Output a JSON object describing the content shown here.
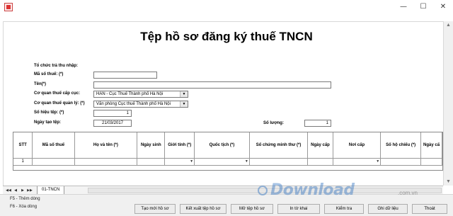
{
  "window": {
    "minimize": "—",
    "maximize": "☐",
    "close": "✕"
  },
  "form": {
    "title": "Tệp hồ sơ đăng ký thuế TNCN",
    "org_label": "Tổ chức trả thu nhập:",
    "tax_code_label": "Mã số thuế: (*)",
    "tax_code_value": "",
    "name_label": "Tên(*)",
    "name_value": "",
    "dept_label": "Cơ quan thuế cấp cục:",
    "dept_value": "HAN - Cục Thuế Thành phố Hà Nội",
    "manager_label": "Cơ quan thuế quản lý: (*)",
    "manager_value": "Văn phòng Cục thuế Thành phố Hà Nội",
    "file_no_label": "Số hiệu tệp: (*)",
    "file_no_value": "1",
    "date_label": "Ngày tạo tệp:",
    "date_value": "21/03/2017",
    "qty_label": "Số lượng:",
    "qty_value": "1"
  },
  "grid": {
    "columns": [
      "STT",
      "Mã số thuế",
      "Họ và tên (*)",
      "Ngày sinh",
      "Giới tính (*)",
      "Quốc tịch (*)",
      "Số chứng minh thư (*)",
      "Ngày cấp",
      "Nơi cấp",
      "Số hộ chiếu (*)",
      "Ngày cấ"
    ],
    "row1": [
      "1",
      "",
      "",
      "",
      "",
      "",
      "",
      "",
      "",
      "",
      ""
    ]
  },
  "tabs": {
    "sheet": "01-TNCN",
    "nav": [
      "◀◀",
      "◀",
      "▶",
      "▶▶"
    ]
  },
  "footer": {
    "hint1": "F5 - Thêm dòng",
    "hint2": "F6 - Xóa dòng",
    "buttons": [
      "Tạo mới hồ sơ",
      "Kết xuất tệp hồ sơ",
      "Mở tệp hồ sơ",
      "In tờ khai",
      "Kiểm tra",
      "Ghi dữ liệu",
      "Thoát"
    ]
  },
  "watermark": {
    "text": "Download",
    "sub": ".com.vn"
  },
  "icons": {
    "dropdown": "chevron-down-icon",
    "app": "app-icon"
  }
}
